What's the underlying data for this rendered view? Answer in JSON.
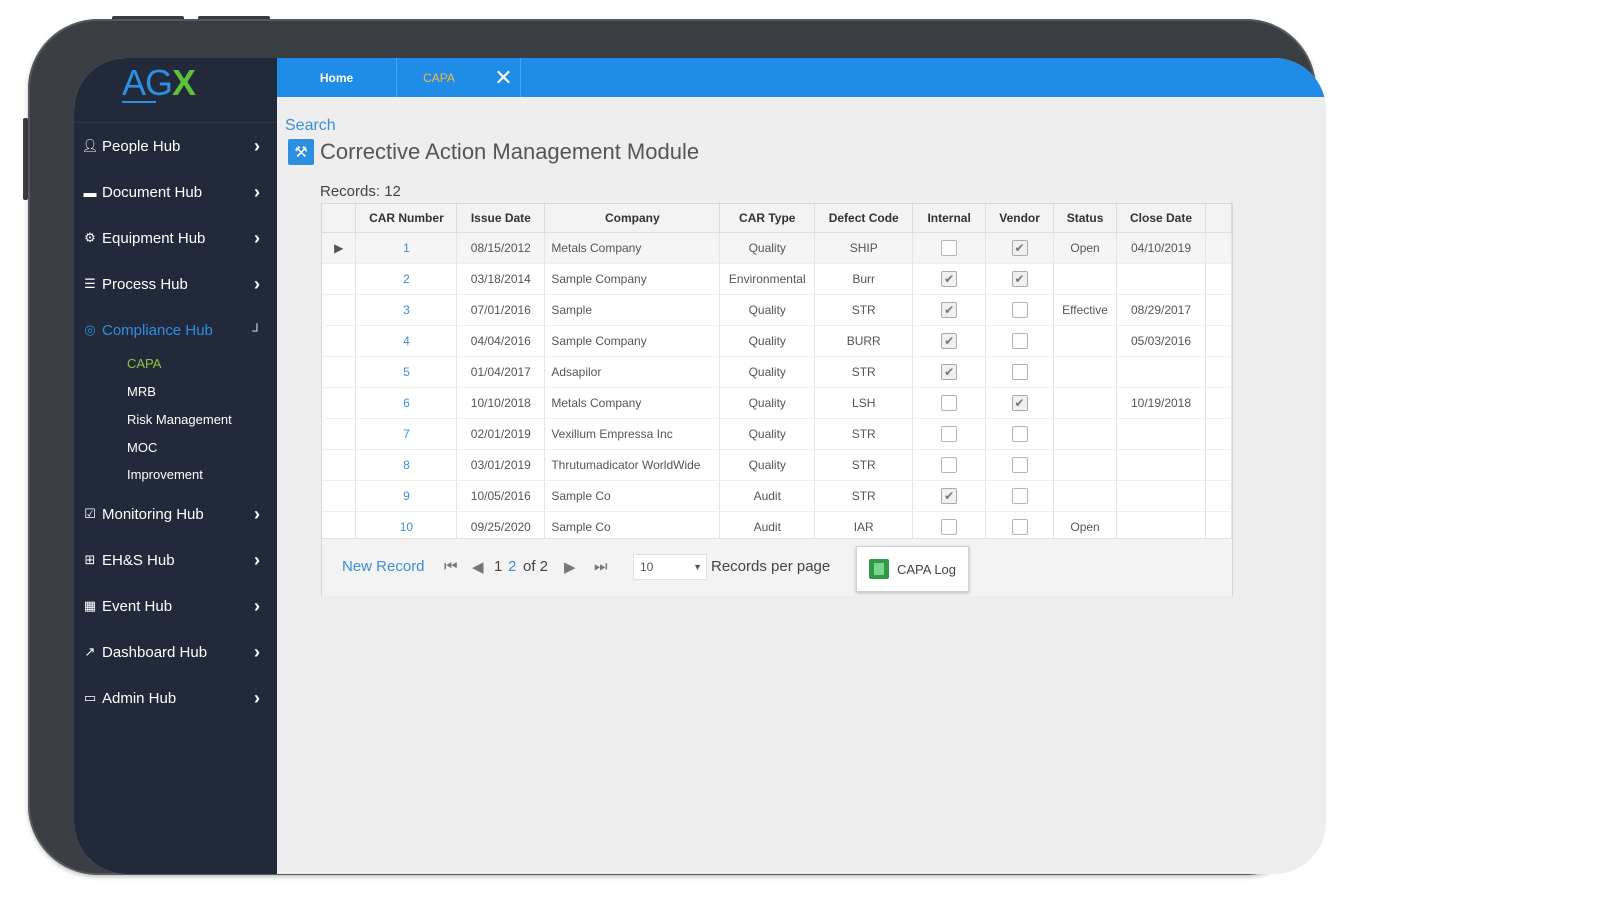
{
  "brand": {
    "logo_ag": "AG",
    "logo_x": "X"
  },
  "tabs": [
    {
      "label": "Home"
    },
    {
      "label": "CAPA"
    }
  ],
  "sidebar": {
    "items": [
      {
        "label": "People Hub",
        "icon": "user-icon"
      },
      {
        "label": "Document Hub",
        "icon": "folder-icon"
      },
      {
        "label": "Equipment Hub",
        "icon": "gears-icon"
      },
      {
        "label": "Process Hub",
        "icon": "list-icon"
      },
      {
        "label": "Compliance Hub",
        "icon": "target-icon",
        "active": true
      },
      {
        "label": "Monitoring Hub",
        "icon": "checkbox-icon"
      },
      {
        "label": "EH&S Hub",
        "icon": "plus-square-icon"
      },
      {
        "label": "Event Hub",
        "icon": "calendar-icon"
      },
      {
        "label": "Dashboard Hub",
        "icon": "line-chart-icon"
      },
      {
        "label": "Admin Hub",
        "icon": "monitor-icon"
      }
    ],
    "compliance_sub": [
      "CAPA",
      "MRB",
      "Risk Management",
      "MOC",
      "Improvement"
    ],
    "current_sub": "CAPA"
  },
  "main": {
    "search_link": "Search",
    "title": "Corrective Action Management Module",
    "records_label": "Records:",
    "records_count": "12"
  },
  "table": {
    "columns": [
      "CAR Number",
      "Issue Date",
      "Company",
      "CAR Type",
      "Defect Code",
      "Internal",
      "Vendor",
      "Status",
      "Close Date"
    ],
    "rows": [
      {
        "car": "1",
        "issue": "08/15/2012",
        "company": "Metals Company",
        "type": "Quality",
        "defect": "SHIP",
        "internal": false,
        "vendor": true,
        "status": "Open",
        "close": "04/10/2019"
      },
      {
        "car": "2",
        "issue": "03/18/2014",
        "company": "Sample Company",
        "type": "Environmental",
        "defect": "Burr",
        "internal": true,
        "vendor": true,
        "status": "",
        "close": ""
      },
      {
        "car": "3",
        "issue": "07/01/2016",
        "company": "Sample",
        "type": "Quality",
        "defect": "STR",
        "internal": true,
        "vendor": false,
        "status": "Effective",
        "close": "08/29/2017"
      },
      {
        "car": "4",
        "issue": "04/04/2016",
        "company": "Sample Company",
        "type": "Quality",
        "defect": "BURR",
        "internal": true,
        "vendor": false,
        "status": "",
        "close": "05/03/2016"
      },
      {
        "car": "5",
        "issue": "01/04/2017",
        "company": "Adsapilor",
        "type": "Quality",
        "defect": "STR",
        "internal": true,
        "vendor": false,
        "status": "",
        "close": ""
      },
      {
        "car": "6",
        "issue": "10/10/2018",
        "company": "Metals Company",
        "type": "Quality",
        "defect": "LSH",
        "internal": false,
        "vendor": true,
        "status": "",
        "close": "10/19/2018"
      },
      {
        "car": "7",
        "issue": "02/01/2019",
        "company": "Vexillum Empressa Inc",
        "type": "Quality",
        "defect": "STR",
        "internal": false,
        "vendor": false,
        "status": "",
        "close": ""
      },
      {
        "car": "8",
        "issue": "03/01/2019",
        "company": "Thrutumadicator WorldWide",
        "type": "Quality",
        "defect": "STR",
        "internal": false,
        "vendor": false,
        "status": "",
        "close": ""
      },
      {
        "car": "9",
        "issue": "10/05/2016",
        "company": "Sample Co",
        "type": "Audit",
        "defect": "STR",
        "internal": true,
        "vendor": false,
        "status": "",
        "close": ""
      },
      {
        "car": "10",
        "issue": "09/25/2020",
        "company": "Sample Co",
        "type": "Audit",
        "defect": "IAR",
        "internal": false,
        "vendor": false,
        "status": "Open",
        "close": ""
      }
    ]
  },
  "pager": {
    "new_record": "New Record",
    "page_current": "1",
    "page_link": "2",
    "of_label": "of 2",
    "per_page_value": "10",
    "per_page_label": "Records per page",
    "capa_log_label": "CAPA Log"
  }
}
